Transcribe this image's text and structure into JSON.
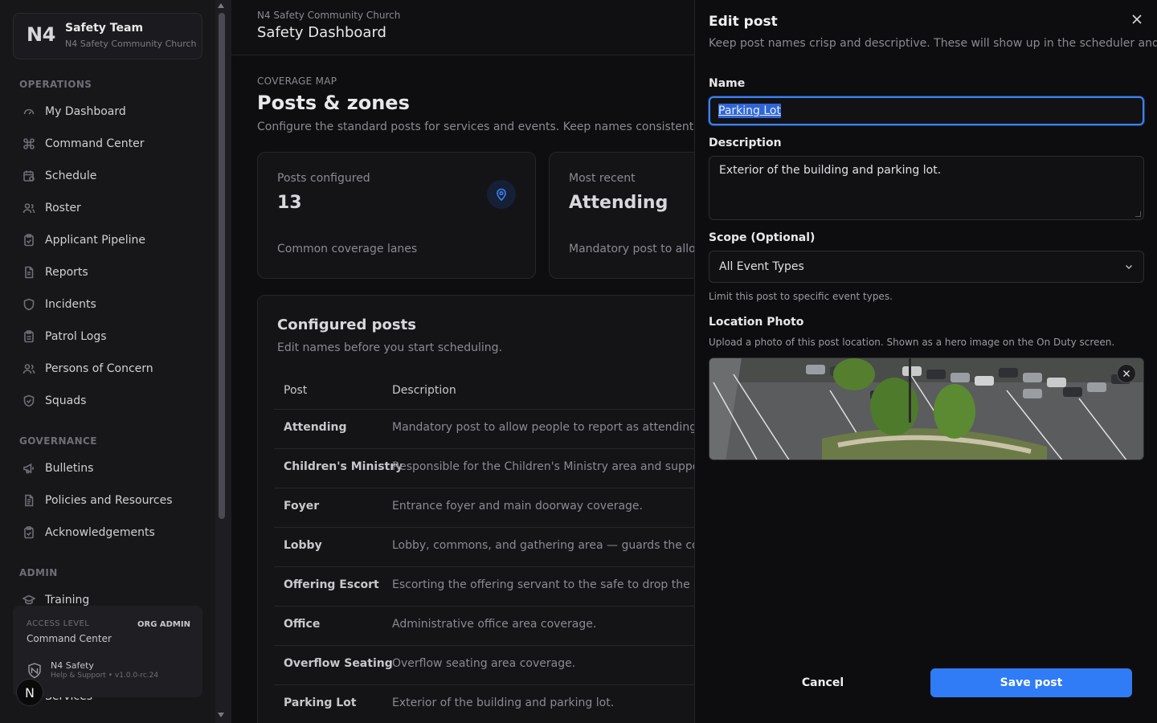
{
  "sidebar": {
    "team_logo": "N4",
    "team_name": "Safety Team",
    "team_org": "N4 Safety Community Church",
    "sections": {
      "operations": "OPERATIONS",
      "governance": "GOVERNANCE",
      "admin": "ADMIN"
    },
    "items": [
      {
        "label": "My Dashboard",
        "icon": "gauge-icon"
      },
      {
        "label": "Command Center",
        "icon": "command-icon"
      },
      {
        "label": "Schedule",
        "icon": "calendar-clock-icon"
      },
      {
        "label": "Roster",
        "icon": "users-icon"
      },
      {
        "label": "Applicant Pipeline",
        "icon": "clipboard-icon"
      },
      {
        "label": "Reports",
        "icon": "file-icon"
      },
      {
        "label": "Incidents",
        "icon": "shield-icon"
      },
      {
        "label": "Patrol Logs",
        "icon": "clipboard-list-icon"
      },
      {
        "label": "Persons of Concern",
        "icon": "user-group-icon"
      },
      {
        "label": "Squads",
        "icon": "shield-check-icon"
      },
      {
        "label": "Bulletins",
        "icon": "megaphone-icon"
      },
      {
        "label": "Policies and Resources",
        "icon": "file-text-icon"
      },
      {
        "label": "Acknowledgements",
        "icon": "clipboard-check-icon"
      },
      {
        "label": "Training",
        "icon": "graduation-cap-icon"
      },
      {
        "label": "Services",
        "icon": "church-icon"
      }
    ],
    "access": {
      "label": "ACCESS LEVEL",
      "value": "Command Center",
      "badge": "ORG ADMIN"
    },
    "brand": {
      "name": "N4 Safety",
      "sub": "Help & Support • v1.0.0-rc.24"
    },
    "avatar_letter": "N"
  },
  "header": {
    "org": "N4 Safety Community Church",
    "title": "Safety Dashboard"
  },
  "page": {
    "eyebrow": "COVERAGE MAP",
    "title": "Posts & zones",
    "subtitle": "Configure the standard posts for services and events. Keep names consistent for scheduling."
  },
  "stats": [
    {
      "label": "Posts configured",
      "value": "13",
      "foot": "Common coverage lanes",
      "icon": "map-pin-icon"
    },
    {
      "label": "Most recent",
      "value": "Attending",
      "foot": "Mandatory post to allow people to report as attending"
    }
  ],
  "posts": {
    "title": "Configured posts",
    "subtitle": "Edit names before you start scheduling.",
    "columns": [
      "Post",
      "Description"
    ],
    "rows": [
      {
        "post": "Attending",
        "desc": "Mandatory post to allow people to report as attending, but not assigned"
      },
      {
        "post": "Children's Ministry",
        "desc": "Responsible for the Children's Ministry area and supporting staff"
      },
      {
        "post": "Foyer",
        "desc": "Entrance foyer and main doorway coverage."
      },
      {
        "post": "Lobby",
        "desc": "Lobby, commons, and gathering area — guards the common spaces"
      },
      {
        "post": "Offering Escort",
        "desc": "Escorting the offering servant to the safe to drop the offering"
      },
      {
        "post": "Office",
        "desc": "Administrative office area coverage."
      },
      {
        "post": "Overflow Seating",
        "desc": "Overflow seating area coverage."
      },
      {
        "post": "Parking Lot",
        "desc": "Exterior of the building and parking lot."
      }
    ]
  },
  "drawer": {
    "title": "Edit post",
    "subtitle": "Keep post names crisp and descriptive. These will show up in the scheduler and swaps.",
    "name_label": "Name",
    "name_value": "Parking Lot",
    "description_label": "Description",
    "description_value": "Exterior of the building and parking lot.",
    "scope_label": "Scope (Optional)",
    "scope_value": "All Event Types",
    "scope_help": "Limit this post to specific event types.",
    "photo_label": "Location Photo",
    "photo_help": "Upload a photo of this post location. Shown as a hero image on the On Duty screen.",
    "cancel_label": "Cancel",
    "save_label": "Save post"
  },
  "colors": {
    "accent": "#2f7cf6",
    "focus_ring": "#3b82f6",
    "background": "#0d0d0f"
  }
}
